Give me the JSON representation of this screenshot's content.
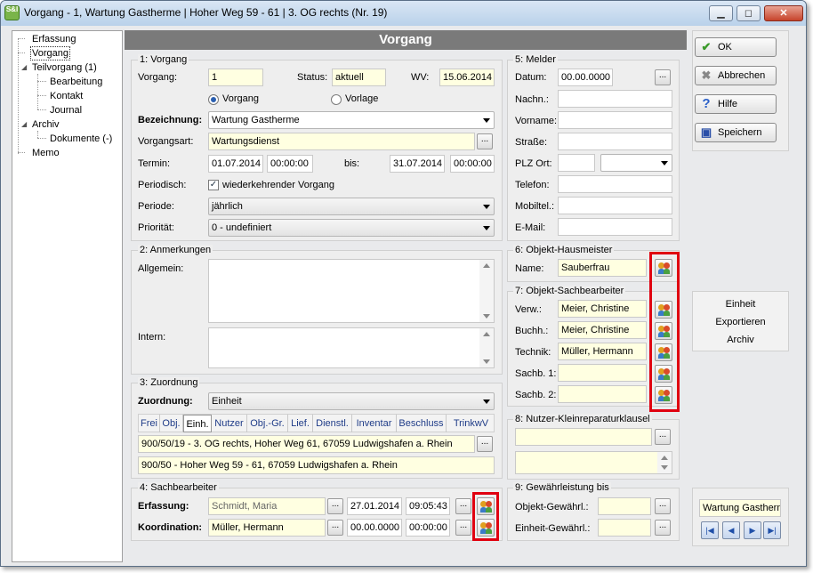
{
  "window": {
    "title": "Vorgang - 1, Wartung Gastherme | Hoher Weg 59 - 61 | 3. OG rechts (Nr. 19)",
    "app_icon_text": "S&I"
  },
  "tree": {
    "items": [
      {
        "label": "Erfassung"
      },
      {
        "label": "Vorgang"
      },
      {
        "label": "Teilvorgang (1)"
      },
      {
        "label": "Bearbeitung"
      },
      {
        "label": "Kontakt"
      },
      {
        "label": "Journal"
      },
      {
        "label": "Archiv"
      },
      {
        "label": "Dokumente (-)"
      },
      {
        "label": "Memo"
      }
    ]
  },
  "header": {
    "title": "Vorgang"
  },
  "vorgang": {
    "group_title": "1: Vorgang",
    "vorgang_label": "Vorgang:",
    "vorgang_value": "1",
    "status_label": "Status:",
    "status_value": "aktuell",
    "wv_label": "WV:",
    "wv_value": "15.06.2014",
    "radio_vorgang": "Vorgang",
    "radio_vorlage": "Vorlage",
    "bezeichnung_label": "Bezeichnung:",
    "bezeichnung_value": "Wartung Gastherme",
    "vorgangsart_label": "Vorgangsart:",
    "vorgangsart_value": "Wartungsdienst",
    "termin_label": "Termin:",
    "termin_date": "01.07.2014",
    "termin_time": "00:00:00",
    "bis_label": "bis:",
    "bis_date": "31.07.2014",
    "bis_time": "00:00:00",
    "periodisch_label": "Periodisch:",
    "periodisch_text": "wiederkehrender Vorgang",
    "periode_label": "Periode:",
    "periode_value": "jährlich",
    "prioritaet_label": "Priorität:",
    "prioritaet_value": "0 - undefiniert"
  },
  "anmerkungen": {
    "group_title": "2: Anmerkungen",
    "allgemein_label": "Allgemein:",
    "intern_label": "Intern:"
  },
  "zuordnung": {
    "group_title": "3: Zuordnung",
    "label": "Zuordnung:",
    "value": "Einheit",
    "tabs": [
      "Frei",
      "Obj.",
      "Einh.",
      "Nutzer",
      "Obj.-Gr.",
      "Lief.",
      "Dienstl.",
      "Inventar",
      "Beschluss",
      "TrinkwV"
    ],
    "line1": "900/50/19 - 3. OG rechts, Hoher Weg 61, 67059 Ludwigshafen a. Rhein",
    "line2": "900/50 - Hoher Weg 59 - 61, 67059 Ludwigshafen a. Rhein"
  },
  "sachbearbeiter": {
    "group_title": "4: Sachbearbeiter",
    "erfassung_label": "Erfassung:",
    "erfassung_name": "Schmidt, Maria",
    "erfassung_date": "27.01.2014",
    "erfassung_time": "09:05:43",
    "koordination_label": "Koordination:",
    "koordination_name": "Müller, Hermann",
    "koordination_date": "00.00.0000",
    "koordination_time": "00:00:00"
  },
  "melder": {
    "group_title": "5: Melder",
    "datum_label": "Datum:",
    "datum_value": "00.00.0000",
    "nachname_label": "Nachn.:",
    "vorname_label": "Vorname:",
    "strasse_label": "Straße:",
    "plz_label": "PLZ Ort:",
    "telefon_label": "Telefon:",
    "mobil_label": "Mobiltel.:",
    "email_label": "E-Mail:"
  },
  "hausmeister": {
    "group_title": "6: Objekt-Hausmeister",
    "name_label": "Name:",
    "name_value": "Sauberfrau"
  },
  "objektsb": {
    "group_title": "7: Objekt-Sachbearbeiter",
    "verw_label": "Verw.:",
    "verw_value": "Meier, Christine",
    "buchh_label": "Buchh.:",
    "buchh_value": "Meier, Christine",
    "technik_label": "Technik:",
    "technik_value": "Müller, Hermann",
    "sachb1_label": "Sachb. 1:",
    "sachb2_label": "Sachb. 2:"
  },
  "nutzer": {
    "group_title": "8: Nutzer-Kleinreparaturklausel"
  },
  "gewaehr": {
    "group_title": "9: Gewährleistung bis",
    "objekt_label": "Objekt-Gewährl.:",
    "einheit_label": "Einheit-Gewährl.:"
  },
  "actions": {
    "ok": "OK",
    "abbrechen": "Abbrechen",
    "hilfe": "Hilfe",
    "speichern": "Speichern"
  },
  "side_panel": {
    "line1": "Einheit",
    "line2": "Exportieren",
    "line3": "Archiv"
  },
  "record": {
    "current": "Wartung Gastherme"
  },
  "colors": {
    "header": "#7a7a7a",
    "highlight": "#e00010",
    "yellow_field": "#ffffe1"
  }
}
